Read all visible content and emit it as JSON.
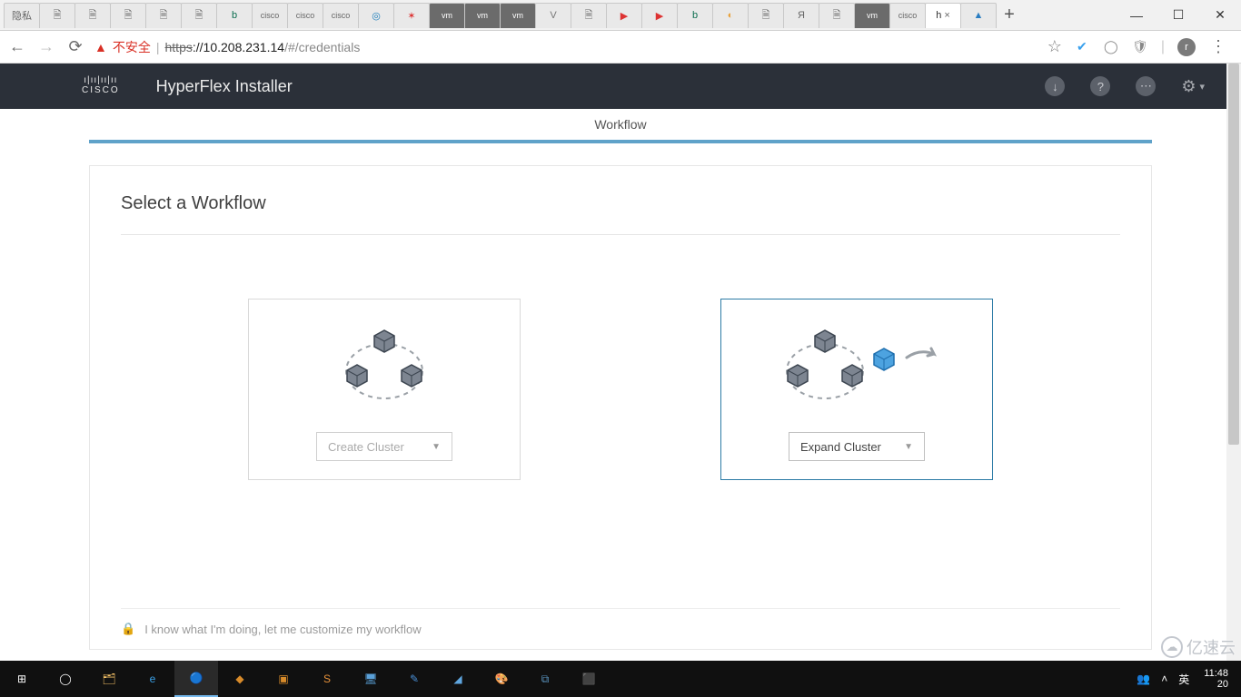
{
  "browser": {
    "incognito_label": "隐私",
    "not_secure": "不安全",
    "url_scheme": "https",
    "url_host": "://10.208.231.14",
    "url_path": "/#/credentials",
    "avatar_letter": "r",
    "new_tab": "+",
    "active_tab_label": "h",
    "close_tab": "×"
  },
  "window_controls": {
    "min": "—",
    "max": "☐",
    "close": "✕"
  },
  "header": {
    "brand_top": "ı|ıı|ıı|ıı",
    "brand_bottom": "CISCO",
    "title": "HyperFlex Installer",
    "download": "↓",
    "help": "?",
    "more": "⋯",
    "settings": "⚙",
    "settings_caret": "▾"
  },
  "workflow_tab": "Workflow",
  "page": {
    "title": "Select a Workflow",
    "options": {
      "create": {
        "label": "Create Cluster"
      },
      "expand": {
        "label": "Expand Cluster"
      }
    },
    "footer": "I know what I'm doing, let me customize my workflow",
    "lock_icon": "🔒"
  },
  "taskbar": {
    "time": "11:48",
    "date_prefix": "20",
    "ime": "英",
    "tray_caret": "˄",
    "tray_people": "👥"
  },
  "watermark": "亿速云"
}
